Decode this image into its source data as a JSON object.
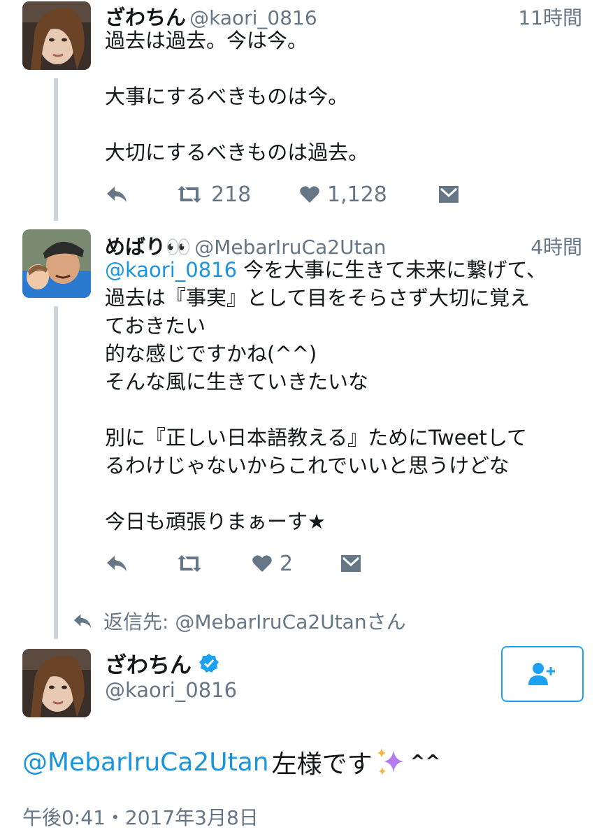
{
  "tweets": [
    {
      "display_name": "ざわちん",
      "handle": "@kaori_0816",
      "time": "11時間",
      "text": "過去は過去。今は今。\n\n大事にするべきものは今。\n\n大切にするべきものは過去。",
      "retweets": "218",
      "likes": "1,128"
    },
    {
      "display_name": "めばり👀",
      "handle": "@MebarIruCa2Utan",
      "time": "4時間",
      "mention": "@kaori_0816",
      "text_first_line": " 今を大事に生きて未来に繋げて、",
      "text": "過去は『事実』として目をそらさず大切に覚え\nておきたい\n的な感じですかね(^^)\nそんな風に生きていきたいな\n\n別に『正しい日本語教える』ためにTweetして\nるわけじゃないからこれでいいと思うけどな\n\n今日も頑張りまぁーす★",
      "retweets": "",
      "likes": "2"
    }
  ],
  "reply_to": "返信先: @MebarIruCa2Utanさん",
  "main_tweet": {
    "display_name": "ざわちん",
    "handle": "@kaori_0816",
    "mention": "@MebarIruCa2Utan",
    "text": " 左様です",
    "emoji_tail": "^^",
    "timestamp": "午後0:41・2017年3月8日",
    "verified": true
  },
  "icons": [
    "reply-icon",
    "retweet-icon",
    "heart-icon",
    "dm-icon",
    "verified-badge-icon",
    "follow-user-icon",
    "sparkles-icon"
  ],
  "colors": {
    "link": "#1b95e0",
    "muted": "#657786",
    "accent": "#1da1f2",
    "thread_line": "#ccd6dd"
  }
}
